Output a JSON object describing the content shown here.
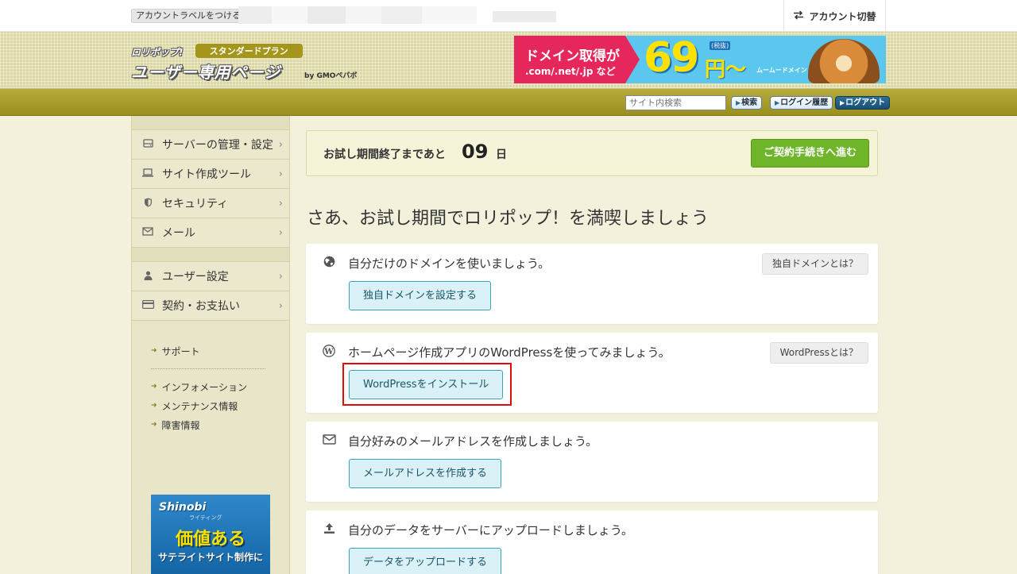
{
  "topbar": {
    "label_button": "アカウントラベルをつける",
    "account_switch": "アカウント切替"
  },
  "header": {
    "logo_top": "ロリポップ!",
    "plan": "スタンダードプラン",
    "logo_main": "ユーザー専用ページ",
    "logo_by": "by GMOペパボ",
    "banner": {
      "line1": "ドメイン取得が",
      "line2": ".com/.net/.jp など",
      "price": "69",
      "yen": "円〜",
      "tax": "(税抜)",
      "brand": "ムームードメイン"
    }
  },
  "nav": {
    "search_placeholder": "サイト内検索",
    "search_btn": "検索",
    "login_history": "ログイン履歴",
    "logout": "ログアウト"
  },
  "sidebar": {
    "items": [
      {
        "label": "サーバーの管理・設定",
        "icon": "server-icon"
      },
      {
        "label": "サイト作成ツール",
        "icon": "laptop-icon"
      },
      {
        "label": "セキュリティ",
        "icon": "shield-icon"
      },
      {
        "label": "メール",
        "icon": "mail-icon"
      }
    ],
    "items2": [
      {
        "label": "ユーザー設定",
        "icon": "user-icon"
      },
      {
        "label": "契約・お支払い",
        "icon": "credit-card-icon"
      }
    ],
    "links": [
      "サポート",
      "インフォメーション",
      "メンテナンス情報",
      "障害情報"
    ],
    "ad": {
      "logo": "Shinobi",
      "sub": "ライティング",
      "big": "価値ある",
      "small": "サテライトサイト制作に"
    }
  },
  "trial": {
    "text": "お試し期間終了まであと",
    "days": "09",
    "unit": "日",
    "button": "ご契約手続きへ進む"
  },
  "headline": "さあ、お試し期間でロリポップ！を満喫しましょう",
  "cards": [
    {
      "icon": "globe-icon",
      "text": "自分だけのドメインを使いましょう。",
      "help": "独自ドメインとは？",
      "button": "独自ドメインを設定する"
    },
    {
      "icon": "wordpress-icon",
      "text": "ホームページ作成アプリのWordPressを使ってみましょう。",
      "help": "WordPressとは？",
      "button": "WordPressをインストール"
    },
    {
      "icon": "envelope-icon",
      "text": "自分好みのメールアドレスを作成しましょう。",
      "help": "",
      "button": "メールアドレスを作成する"
    },
    {
      "icon": "upload-icon",
      "text": "自分のデータをサーバーにアップロードしましょう。",
      "help": "",
      "button": "データをアップロードする"
    }
  ],
  "colors": {
    "header_bg": "#dcd8a5",
    "navbar": "#a89d2b",
    "sidebar_bg": "#e8e5c8",
    "contract_btn": "#6fb52a",
    "action_btn_border": "#34a6c2",
    "highlight": "#e30b0b"
  }
}
